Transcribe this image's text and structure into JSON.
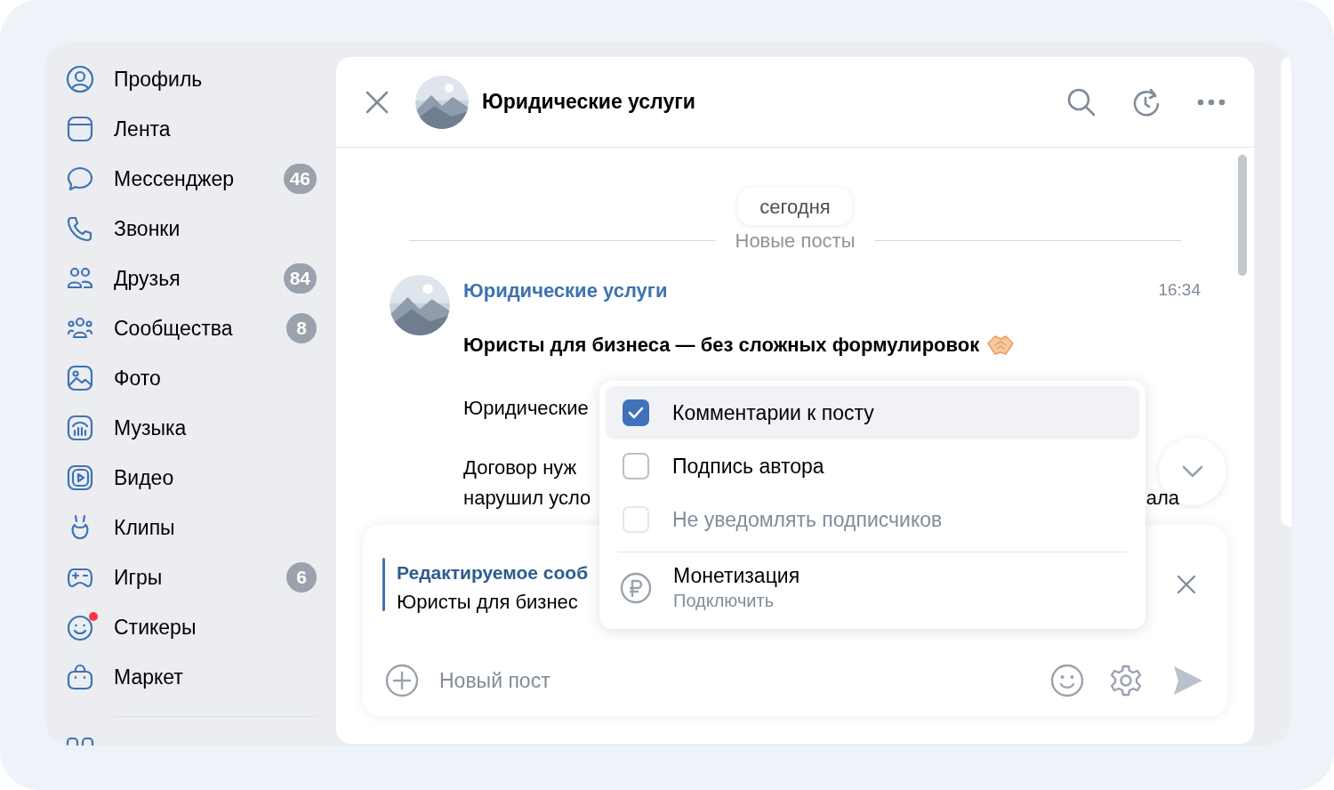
{
  "sidebar": {
    "items": [
      {
        "label": "Профиль"
      },
      {
        "label": "Лента"
      },
      {
        "label": "Мессенджер",
        "badge": "46"
      },
      {
        "label": "Звонки"
      },
      {
        "label": "Друзья",
        "badge": "84"
      },
      {
        "label": "Сообщества",
        "badge": "8"
      },
      {
        "label": "Фото"
      },
      {
        "label": "Музыка"
      },
      {
        "label": "Видео"
      },
      {
        "label": "Клипы"
      },
      {
        "label": "Игры",
        "badge": "6"
      },
      {
        "label": "Стикеры",
        "dot": true
      },
      {
        "label": "Маркет"
      }
    ]
  },
  "header": {
    "title": "Юридические услуги"
  },
  "feed": {
    "date_chip": "сегодня",
    "separator": "Новые посты",
    "post": {
      "author": "Юридические услуги",
      "time": "16:34",
      "title": "Юристы для бизнеса — без сложных формулировок",
      "fragments": [
        "Юридические",
        "Договор нуж",
        "нарушил усло"
      ],
      "right_fragment": "ала"
    }
  },
  "menu": {
    "items": [
      {
        "kind": "checkbox",
        "label": "Комментарии к посту",
        "checked": true,
        "disabled": false,
        "highlighted": true
      },
      {
        "kind": "checkbox",
        "label": "Подпись автора",
        "checked": false,
        "disabled": false,
        "highlighted": false
      },
      {
        "kind": "checkbox",
        "label": "Не уведомлять подписчиков",
        "checked": false,
        "disabled": true,
        "highlighted": false
      },
      {
        "kind": "action",
        "label": "Монетизация",
        "sublabel": "Подключить"
      }
    ]
  },
  "composer": {
    "editing_label": "Редактируемое сооб",
    "editing_text": "Юристы для бизнес",
    "placeholder": "Новый пост"
  }
}
